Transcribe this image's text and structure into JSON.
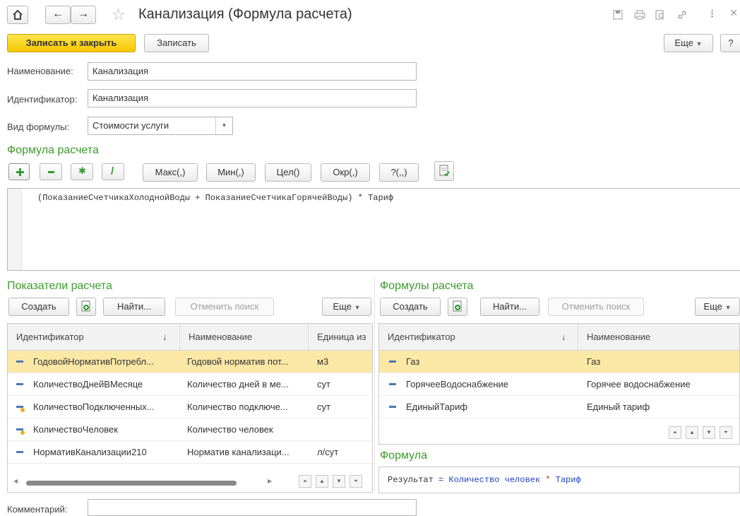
{
  "window": {
    "title": "Канализация (Формула расчета)",
    "close": "×",
    "more": "⁝"
  },
  "toolbar": {
    "save_close": "Записать и закрыть",
    "save": "Записать",
    "more": "Еще",
    "help": "?"
  },
  "form": {
    "name_label": "Наименование:",
    "name_value": "Канализация",
    "id_label": "Идентификатор:",
    "id_value": "Канализация",
    "kind_label": "Вид формулы:",
    "kind_value": "Стоимости услуги"
  },
  "formula_section": {
    "title": "Формула расчета",
    "func_buttons": [
      "Макс(,)",
      "Мин(,)",
      "Цел()",
      "Окр(,)",
      "?(,,)"
    ],
    "text": "(ПоказаниеСчетчикаХолоднойВоды + ПоказаниеСчетчикаГорячейВоды) * Тариф"
  },
  "indicators": {
    "title": "Показатели расчета",
    "create": "Создать",
    "find": "Найти...",
    "cancel_search": "Отменить поиск",
    "more": "Еще",
    "columns": [
      "Идентификатор",
      "Наименование",
      "Единица из"
    ],
    "sort_arrow": "↓",
    "rows": [
      {
        "id": "ГодовойНормативПотребл...",
        "name": "Годовой норматив пот...",
        "unit": "м3",
        "icon": "dash-icon"
      },
      {
        "id": "КоличествоДнейВМесяце",
        "name": "Количество дней в ме...",
        "unit": "сут",
        "icon": "dash-icon"
      },
      {
        "id": "КоличествоПодключенных...",
        "name": "Количество подключе...",
        "unit": "сут",
        "icon": "dash-key-icon"
      },
      {
        "id": "КоличествоЧеловек",
        "name": "Количество человек",
        "unit": "",
        "icon": "dash-key-icon"
      },
      {
        "id": "НормативКанализации210",
        "name": "Норматив канализаци...",
        "unit": "л/сут",
        "icon": "dash-icon"
      }
    ]
  },
  "formulas": {
    "title": "Формулы расчета",
    "create": "Создать",
    "find": "Найти...",
    "cancel_search": "Отменить поиск",
    "more": "Еще",
    "columns": [
      "Идентификатор",
      "Наименование"
    ],
    "sort_arrow": "↓",
    "rows": [
      {
        "id": "Газ",
        "name": "Газ"
      },
      {
        "id": "ГорячееВодоснабжение",
        "name": "Горячее водоснабжение"
      },
      {
        "id": "ЕдиныйТариф",
        "name": "Единый тариф"
      }
    ]
  },
  "formula_preview": {
    "title": "Формула",
    "result": "Результат",
    "eq": "=",
    "operand": "Количество человек",
    "op": "*",
    "operand2": "Тариф"
  },
  "comment": {
    "label": "Комментарий:",
    "value": ""
  },
  "colors": {
    "accent_green": "#3c9b2a",
    "selection": "#fbe8a6",
    "primary": "#f5c700",
    "formula_blue": "#1f3fbf",
    "formula_red": "#d0261e"
  }
}
